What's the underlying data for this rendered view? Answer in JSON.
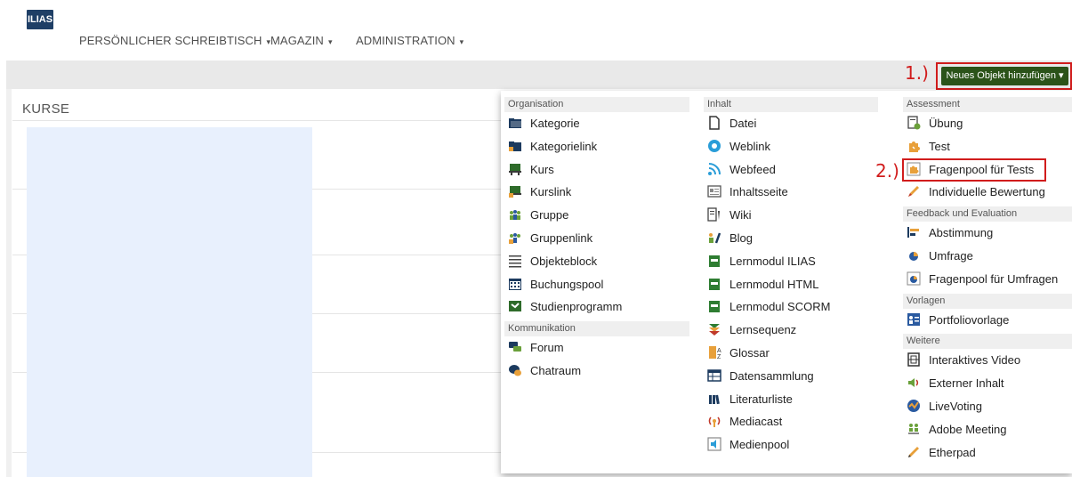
{
  "header": {
    "logo_text": "ILIAS",
    "nav": [
      {
        "label": "PERSÖNLICHER SCHREIBTISCH",
        "caret": "▾"
      },
      {
        "label": "MAGAZIN",
        "caret": "▾"
      },
      {
        "label": "ADMINISTRATION",
        "caret": "▾"
      }
    ]
  },
  "page": {
    "section_title": "KURSE",
    "new_object_button": "Neues Objekt hinzufügen ▾"
  },
  "annotations": {
    "step1": "1.)",
    "step2": "2.)",
    "highlight_color": "#d11c1c"
  },
  "dropdown": {
    "columns": [
      {
        "groups": [
          {
            "title": "Organisation",
            "items": [
              {
                "label": "Kategorie",
                "icon": "folder-icon"
              },
              {
                "label": "Kategorielink",
                "icon": "folder-link-icon"
              },
              {
                "label": "Kurs",
                "icon": "course-icon"
              },
              {
                "label": "Kurslink",
                "icon": "course-link-icon"
              },
              {
                "label": "Gruppe",
                "icon": "group-icon"
              },
              {
                "label": "Gruppenlink",
                "icon": "group-link-icon"
              },
              {
                "label": "Objekteblock",
                "icon": "list-icon"
              },
              {
                "label": "Buchungspool",
                "icon": "calendar-icon"
              },
              {
                "label": "Studienprogramm",
                "icon": "study-programme-icon"
              }
            ]
          },
          {
            "title": "Kommunikation",
            "items": [
              {
                "label": "Forum",
                "icon": "forum-icon"
              },
              {
                "label": "Chatraum",
                "icon": "chat-icon"
              }
            ]
          }
        ]
      },
      {
        "groups": [
          {
            "title": "Inhalt",
            "items": [
              {
                "label": "Datei",
                "icon": "file-icon"
              },
              {
                "label": "Weblink",
                "icon": "weblink-icon"
              },
              {
                "label": "Webfeed",
                "icon": "rss-icon"
              },
              {
                "label": "Inhaltsseite",
                "icon": "content-page-icon"
              },
              {
                "label": "Wiki",
                "icon": "wiki-icon"
              },
              {
                "label": "Blog",
                "icon": "blog-icon"
              },
              {
                "label": "Lernmodul ILIAS",
                "icon": "learning-module-icon"
              },
              {
                "label": "Lernmodul HTML",
                "icon": "learning-module-html-icon"
              },
              {
                "label": "Lernmodul SCORM",
                "icon": "learning-module-scorm-icon"
              },
              {
                "label": "Lernsequenz",
                "icon": "learning-sequence-icon"
              },
              {
                "label": "Glossar",
                "icon": "glossary-icon"
              },
              {
                "label": "Datensammlung",
                "icon": "table-icon"
              },
              {
                "label": "Literaturliste",
                "icon": "books-icon"
              },
              {
                "label": "Mediacast",
                "icon": "broadcast-icon"
              },
              {
                "label": "Medienpool",
                "icon": "media-pool-icon"
              }
            ]
          }
        ]
      },
      {
        "groups": [
          {
            "title": "Assessment",
            "items": [
              {
                "label": "Übung",
                "icon": "exercise-icon"
              },
              {
                "label": "Test",
                "icon": "puzzle-icon"
              },
              {
                "label": "Fragenpool für Tests",
                "icon": "question-pool-icon"
              },
              {
                "label": "Individuelle Bewertung",
                "icon": "pen-icon"
              }
            ]
          },
          {
            "title": "Feedback und Evaluation",
            "items": [
              {
                "label": "Abstimmung",
                "icon": "poll-icon"
              },
              {
                "label": "Umfrage",
                "icon": "survey-icon"
              },
              {
                "label": "Fragenpool für Umfragen",
                "icon": "survey-pool-icon"
              }
            ]
          },
          {
            "title": "Vorlagen",
            "items": [
              {
                "label": "Portfoliovorlage",
                "icon": "portfolio-icon"
              }
            ]
          },
          {
            "title": "Weitere",
            "items": [
              {
                "label": "Interaktives Video",
                "icon": "film-icon"
              },
              {
                "label": "Externer Inhalt",
                "icon": "speaker-icon"
              },
              {
                "label": "LiveVoting",
                "icon": "livevoting-icon"
              },
              {
                "label": "Adobe Meeting",
                "icon": "meeting-icon"
              },
              {
                "label": "Etherpad",
                "icon": "pencil-icon"
              }
            ]
          }
        ]
      }
    ]
  }
}
